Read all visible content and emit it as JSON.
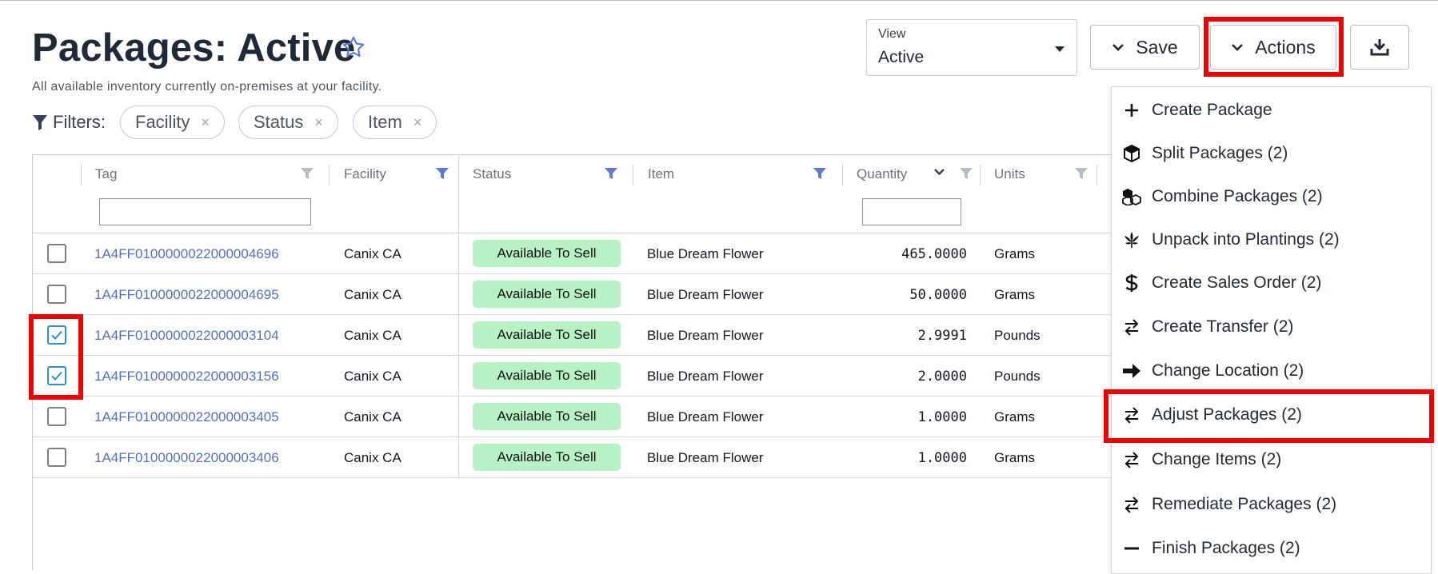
{
  "page": {
    "title": "Packages: Active",
    "subtitle": "All available inventory currently on-premises at your facility."
  },
  "filters": {
    "label": "Filters:",
    "chips": [
      "Facility",
      "Status",
      "Item"
    ],
    "remove_glyph": "×"
  },
  "view": {
    "label": "View",
    "value": "Active"
  },
  "toolbar": {
    "save_label": "Save",
    "actions_label": "Actions"
  },
  "table": {
    "columns": [
      "Tag",
      "Facility",
      "Status",
      "Item",
      "Quantity",
      "Units"
    ],
    "rows": [
      {
        "tag": "1A4FF0100000022000004696",
        "facility": "Canix CA",
        "status": "Available To Sell",
        "item": "Blue Dream Flower",
        "quantity": "465.0000",
        "units": "Grams",
        "checked": false
      },
      {
        "tag": "1A4FF0100000022000004695",
        "facility": "Canix CA",
        "status": "Available To Sell",
        "item": "Blue Dream Flower",
        "quantity": "50.0000",
        "units": "Grams",
        "checked": false
      },
      {
        "tag": "1A4FF0100000022000003104",
        "facility": "Canix CA",
        "status": "Available To Sell",
        "item": "Blue Dream Flower",
        "quantity": "2.9991",
        "units": "Pounds",
        "checked": true
      },
      {
        "tag": "1A4FF0100000022000003156",
        "facility": "Canix CA",
        "status": "Available To Sell",
        "item": "Blue Dream Flower",
        "quantity": "2.0000",
        "units": "Pounds",
        "checked": true
      },
      {
        "tag": "1A4FF0100000022000003405",
        "facility": "Canix CA",
        "status": "Available To Sell",
        "item": "Blue Dream Flower",
        "quantity": "1.0000",
        "units": "Grams",
        "checked": false
      },
      {
        "tag": "1A4FF0100000022000003406",
        "facility": "Canix CA",
        "status": "Available To Sell",
        "item": "Blue Dream Flower",
        "quantity": "1.0000",
        "units": "Grams",
        "checked": false
      }
    ]
  },
  "actions_menu": {
    "items": [
      {
        "label": "Create Package",
        "icon": "plus-icon"
      },
      {
        "label": "Split Packages (2)",
        "icon": "box-icon"
      },
      {
        "label": "Combine Packages (2)",
        "icon": "boxes-icon"
      },
      {
        "label": "Unpack into Plantings (2)",
        "icon": "cannabis-leaf-icon"
      },
      {
        "label": "Create Sales Order (2)",
        "icon": "dollar-icon"
      },
      {
        "label": "Create Transfer (2)",
        "icon": "exchange-arrows-icon"
      },
      {
        "label": "Change Location (2)",
        "icon": "arrow-right-icon"
      },
      {
        "label": "Adjust Packages (2)",
        "icon": "exchange-arrows-icon"
      },
      {
        "label": "Change Items (2)",
        "icon": "exchange-arrows-icon"
      },
      {
        "label": "Remediate Packages (2)",
        "icon": "exchange-arrows-icon"
      },
      {
        "label": "Finish Packages (2)",
        "icon": "minus-icon"
      }
    ]
  },
  "colors": {
    "highlight": "#ee0000",
    "link": "#5272b8",
    "status_bg": "#b8f1c4",
    "filter_icon_active": "#5b7bd5",
    "filter_icon_inactive": "#b8bcc4",
    "checkbox_checked": "#2f8fc8"
  }
}
